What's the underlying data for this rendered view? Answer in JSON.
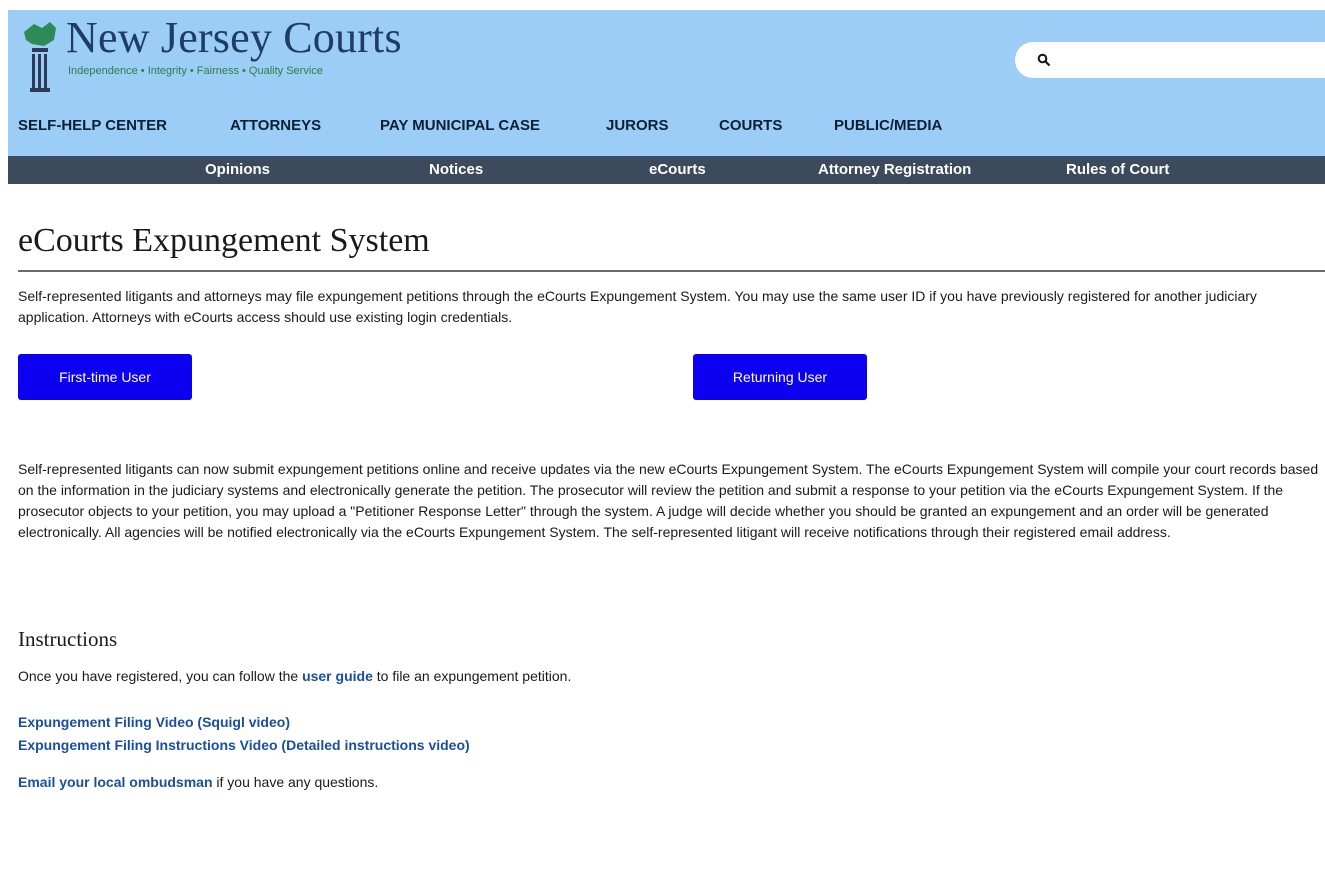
{
  "header": {
    "title": "New Jersey Courts",
    "tagline": "Independence • Integrity • Fairness • Quality Service",
    "search": {
      "placeholder": ""
    }
  },
  "main_nav": [
    "SELF-HELP CENTER",
    "ATTORNEYS",
    "PAY MUNICIPAL CASE",
    "JURORS",
    "COURTS",
    "PUBLIC/MEDIA"
  ],
  "sub_nav": [
    "Opinions",
    "Notices",
    "eCourts",
    "Attorney Registration",
    "Rules of Court"
  ],
  "page": {
    "title": "eCourts Expungement System",
    "intro": "Self-represented litigants and attorneys may file expungement petitions through the eCourts Expungement System. You may use the same user ID if you have previously registered for another judiciary application. Attorneys with eCourts access should use existing login credentials.",
    "buttons": {
      "first_time": "First-time User",
      "returning": "Returning User"
    },
    "body": "Self-represented litigants can now submit expungement petitions online and receive updates via the new eCourts Expungement System. The eCourts Expungement System will compile your court records based on the information in the judiciary systems and electronically generate the petition. The prosecutor will review the petition and submit a response to your petition via the eCourts Expungement System. If the prosecutor objects to your petition, you may upload a \"Petitioner Response Letter\" through the system. A judge will decide whether you should be granted an expungement and an order will be generated electronically. All agencies will be notified electronically via the eCourts Expungement System. The self-represented litigant will receive notifications through their registered email address.",
    "instructions": {
      "heading": "Instructions",
      "guide_prefix": "Once you have registered, you can follow the",
      "guide_link": "user guide",
      "guide_suffix": "to file an expungement petition.",
      "video1": "Expungement Filing Video (Squigl video)",
      "video2": "Expungement Filing Instructions Video (Detailed instructions video)",
      "email_link": "Email your local ombudsman",
      "email_suffix": "if you have any questions."
    }
  },
  "colors": {
    "header_bg": "#9bcdf7",
    "subnav_bg": "#3b4a5c",
    "button_bg": "#0c00f0",
    "link": "#1a4fa0"
  },
  "icons": [
    "courthouse-logo-icon",
    "search-icon"
  ]
}
